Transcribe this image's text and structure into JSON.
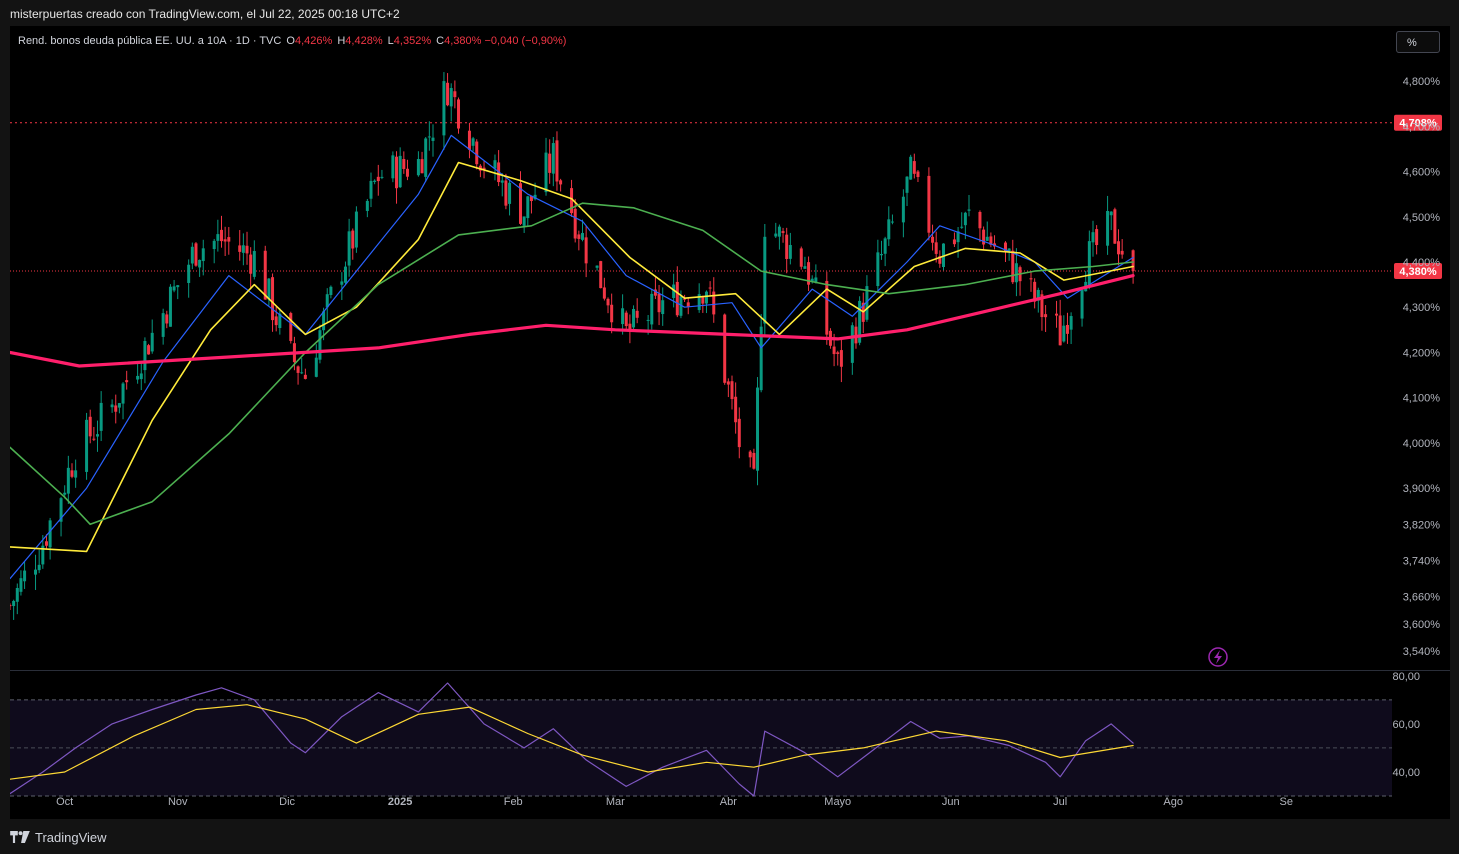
{
  "header": {
    "caption": "misterpuertas creado con TradingView.com, el Jul 22, 2025 00:18 UTC+2"
  },
  "legend": {
    "title": "Rend. bonos deuda pública EE. UU. a 10A · 1D · TVC",
    "o_label": "O",
    "o_value": "4,426%",
    "h_label": "H",
    "h_value": "4,428%",
    "l_label": "L",
    "l_value": "4,352%",
    "c_label": "C",
    "c_value": "4,380%",
    "change": "−0,040 (−0,90%)"
  },
  "unit_button": {
    "label": "%"
  },
  "footer": {
    "brand": "TradingView"
  },
  "colors": {
    "up": "#089981",
    "down": "#f23645",
    "ema_fast": "#2962ff",
    "ema_mid": "#ffeb3b",
    "sma_green": "#4caf50",
    "sma_long": "#ff1f6b",
    "rsi": "#7e57c2",
    "rsi_ma": "#fdd835",
    "price_label": "#f23645"
  },
  "chart_data": [
    {
      "type": "candlestick",
      "y_unit": "%",
      "ylim": [
        3.5,
        4.86
      ],
      "y_ticks": [
        "4,800%",
        "4,700%",
        "4,600%",
        "4,500%",
        "4,400%",
        "4,300%",
        "4,200%",
        "4,100%",
        "4,000%",
        "3,900%",
        "3,820%",
        "3,740%",
        "3,660%",
        "3,600%",
        "3,540%"
      ],
      "y_tick_values": [
        4.8,
        4.7,
        4.6,
        4.5,
        4.4,
        4.3,
        4.2,
        4.1,
        4.0,
        3.9,
        3.82,
        3.74,
        3.66,
        3.6,
        3.54
      ],
      "x_labels": [
        "Oct",
        "Nov",
        "Dic",
        "2025",
        "Feb",
        "Mar",
        "Abr",
        "Mayo",
        "Jun",
        "Jul",
        "Ago",
        "Se"
      ],
      "x_label_dates": [
        "2024-10-01",
        "2024-11-01",
        "2024-12-01",
        "2025-01-01",
        "2025-02-01",
        "2025-03-01",
        "2025-04-01",
        "2025-05-01",
        "2025-06-01",
        "2025-07-01",
        "2025-08-01",
        "2025-09-01"
      ],
      "x_range": [
        "2024-09-16",
        "2025-09-30"
      ],
      "close_series": {
        "name": "",
        "points": [
          [
            "2024-09-16",
            3.64
          ],
          [
            "2024-09-25",
            3.78
          ],
          [
            "2024-10-04",
            3.98
          ],
          [
            "2024-10-14",
            4.08
          ],
          [
            "2024-10-25",
            4.24
          ],
          [
            "2024-11-06",
            4.43
          ],
          [
            "2024-11-13",
            4.45
          ],
          [
            "2024-11-22",
            4.41
          ],
          [
            "2024-12-02",
            4.19
          ],
          [
            "2024-12-06",
            4.15
          ],
          [
            "2024-12-16",
            4.39
          ],
          [
            "2024-12-26",
            4.59
          ],
          [
            "2025-01-06",
            4.62
          ],
          [
            "2025-01-14",
            4.79
          ],
          [
            "2025-01-24",
            4.62
          ],
          [
            "2025-02-04",
            4.51
          ],
          [
            "2025-02-12",
            4.63
          ],
          [
            "2025-02-21",
            4.43
          ],
          [
            "2025-03-04",
            4.24
          ],
          [
            "2025-03-14",
            4.31
          ],
          [
            "2025-03-26",
            4.35
          ],
          [
            "2025-04-04",
            4.0
          ],
          [
            "2025-04-08",
            3.9
          ],
          [
            "2025-04-11",
            4.49
          ],
          [
            "2025-04-22",
            4.4
          ],
          [
            "2025-05-01",
            4.17
          ],
          [
            "2025-05-08",
            4.3
          ],
          [
            "2025-05-21",
            4.59
          ],
          [
            "2025-05-29",
            4.42
          ],
          [
            "2025-06-06",
            4.5
          ],
          [
            "2025-06-17",
            4.4
          ],
          [
            "2025-06-27",
            4.28
          ],
          [
            "2025-07-01",
            4.24
          ],
          [
            "2025-07-08",
            4.4
          ],
          [
            "2025-07-15",
            4.48
          ],
          [
            "2025-07-21",
            4.38
          ]
        ]
      },
      "ohlc_last": {
        "date": "2025-07-21",
        "open": 4.426,
        "high": 4.428,
        "low": 4.352,
        "close": 4.38
      },
      "moving_averages": [
        {
          "name": "",
          "color": "#2962ff",
          "points": [
            [
              "2024-09-16",
              3.7
            ],
            [
              "2024-10-07",
              3.9
            ],
            [
              "2024-10-28",
              4.18
            ],
            [
              "2024-11-15",
              4.37
            ],
            [
              "2024-12-06",
              4.24
            ],
            [
              "2024-12-20",
              4.38
            ],
            [
              "2025-01-06",
              4.55
            ],
            [
              "2025-01-15",
              4.68
            ],
            [
              "2025-02-05",
              4.55
            ],
            [
              "2025-02-20",
              4.49
            ],
            [
              "2025-03-04",
              4.37
            ],
            [
              "2025-03-20",
              4.3
            ],
            [
              "2025-04-02",
              4.31
            ],
            [
              "2025-04-10",
              4.21
            ],
            [
              "2025-04-24",
              4.34
            ],
            [
              "2025-05-05",
              4.28
            ],
            [
              "2025-05-20",
              4.4
            ],
            [
              "2025-05-29",
              4.48
            ],
            [
              "2025-06-12",
              4.44
            ],
            [
              "2025-06-24",
              4.4
            ],
            [
              "2025-07-03",
              4.32
            ],
            [
              "2025-07-21",
              4.41
            ]
          ]
        },
        {
          "name": "",
          "color": "#ffeb3b",
          "points": [
            [
              "2024-09-16",
              3.77
            ],
            [
              "2024-10-07",
              3.76
            ],
            [
              "2024-10-25",
              4.05
            ],
            [
              "2024-11-10",
              4.25
            ],
            [
              "2024-11-22",
              4.35
            ],
            [
              "2024-12-06",
              4.24
            ],
            [
              "2024-12-20",
              4.3
            ],
            [
              "2025-01-06",
              4.45
            ],
            [
              "2025-01-17",
              4.62
            ],
            [
              "2025-02-03",
              4.58
            ],
            [
              "2025-02-17",
              4.54
            ],
            [
              "2025-03-05",
              4.41
            ],
            [
              "2025-03-20",
              4.32
            ],
            [
              "2025-04-03",
              4.33
            ],
            [
              "2025-04-15",
              4.24
            ],
            [
              "2025-04-28",
              4.34
            ],
            [
              "2025-05-08",
              4.29
            ],
            [
              "2025-05-22",
              4.39
            ],
            [
              "2025-06-05",
              4.43
            ],
            [
              "2025-06-20",
              4.42
            ],
            [
              "2025-07-02",
              4.36
            ],
            [
              "2025-07-21",
              4.39
            ]
          ]
        },
        {
          "name": "",
          "color": "#4caf50",
          "points": [
            [
              "2024-09-16",
              3.99
            ],
            [
              "2024-10-01",
              3.88
            ],
            [
              "2024-10-08",
              3.82
            ],
            [
              "2024-10-25",
              3.87
            ],
            [
              "2024-11-15",
              4.02
            ],
            [
              "2024-12-06",
              4.2
            ],
            [
              "2024-12-26",
              4.35
            ],
            [
              "2025-01-17",
              4.46
            ],
            [
              "2025-02-06",
              4.48
            ],
            [
              "2025-02-20",
              4.53
            ],
            [
              "2025-03-06",
              4.52
            ],
            [
              "2025-03-25",
              4.47
            ],
            [
              "2025-04-10",
              4.38
            ],
            [
              "2025-04-28",
              4.35
            ],
            [
              "2025-05-15",
              4.33
            ],
            [
              "2025-06-05",
              4.35
            ],
            [
              "2025-06-24",
              4.38
            ],
            [
              "2025-07-10",
              4.39
            ],
            [
              "2025-07-21",
              4.4
            ]
          ]
        },
        {
          "name": "",
          "color": "#ff1f6b",
          "points": [
            [
              "2024-09-16",
              4.2
            ],
            [
              "2024-10-05",
              4.17
            ],
            [
              "2024-11-15",
              4.19
            ],
            [
              "2024-12-26",
              4.21
            ],
            [
              "2025-01-20",
              4.24
            ],
            [
              "2025-02-10",
              4.26
            ],
            [
              "2025-03-01",
              4.25
            ],
            [
              "2025-04-01",
              4.24
            ],
            [
              "2025-05-01",
              4.23
            ],
            [
              "2025-05-20",
              4.25
            ],
            [
              "2025-06-10",
              4.29
            ],
            [
              "2025-07-01",
              4.33
            ],
            [
              "2025-07-21",
              4.37
            ]
          ]
        }
      ],
      "price_lines": [
        {
          "label": "4,708%",
          "value": 4.708,
          "style": "dotted"
        },
        {
          "label": "4,380%",
          "value": 4.38,
          "style": "dotted"
        }
      ]
    },
    {
      "type": "line",
      "ylim": [
        30,
        82
      ],
      "y_ticks": [
        "80,00",
        "60,00",
        "40,00"
      ],
      "y_tick_values": [
        80,
        60,
        40
      ],
      "bands": [
        30,
        70
      ],
      "midline": 50,
      "series": [
        {
          "name": "",
          "color": "#7e57c2",
          "points": [
            [
              "2024-09-16",
              31
            ],
            [
              "2024-09-25",
              40
            ],
            [
              "2024-10-04",
              50
            ],
            [
              "2024-10-14",
              60
            ],
            [
              "2024-10-25",
              66
            ],
            [
              "2024-11-06",
              72
            ],
            [
              "2024-11-13",
              75
            ],
            [
              "2024-11-22",
              70
            ],
            [
              "2024-12-02",
              52
            ],
            [
              "2024-12-06",
              48
            ],
            [
              "2024-12-16",
              63
            ],
            [
              "2024-12-26",
              73
            ],
            [
              "2025-01-06",
              65
            ],
            [
              "2025-01-14",
              77
            ],
            [
              "2025-01-24",
              60
            ],
            [
              "2025-02-04",
              50
            ],
            [
              "2025-02-12",
              58
            ],
            [
              "2025-02-21",
              45
            ],
            [
              "2025-03-04",
              34
            ],
            [
              "2025-03-14",
              42
            ],
            [
              "2025-03-26",
              49
            ],
            [
              "2025-04-04",
              35
            ],
            [
              "2025-04-08",
              30
            ],
            [
              "2025-04-11",
              57
            ],
            [
              "2025-04-22",
              48
            ],
            [
              "2025-05-01",
              38
            ],
            [
              "2025-05-08",
              46
            ],
            [
              "2025-05-21",
              61
            ],
            [
              "2025-05-29",
              54
            ],
            [
              "2025-06-06",
              55
            ],
            [
              "2025-06-17",
              51
            ],
            [
              "2025-06-27",
              44
            ],
            [
              "2025-07-01",
              38
            ],
            [
              "2025-07-08",
              53
            ],
            [
              "2025-07-15",
              60
            ],
            [
              "2025-07-21",
              52
            ]
          ]
        },
        {
          "name": "",
          "color": "#fdd835",
          "points": [
            [
              "2024-09-16",
              37
            ],
            [
              "2024-10-01",
              40
            ],
            [
              "2024-10-20",
              55
            ],
            [
              "2024-11-06",
              66
            ],
            [
              "2024-11-20",
              68
            ],
            [
              "2024-12-06",
              62
            ],
            [
              "2024-12-20",
              52
            ],
            [
              "2025-01-06",
              64
            ],
            [
              "2025-01-20",
              67
            ],
            [
              "2025-02-05",
              56
            ],
            [
              "2025-02-20",
              47
            ],
            [
              "2025-03-10",
              40
            ],
            [
              "2025-03-26",
              44
            ],
            [
              "2025-04-08",
              42
            ],
            [
              "2025-04-22",
              47
            ],
            [
              "2025-05-08",
              50
            ],
            [
              "2025-05-28",
              57
            ],
            [
              "2025-06-16",
              53
            ],
            [
              "2025-07-01",
              46
            ],
            [
              "2025-07-21",
              51
            ]
          ]
        }
      ]
    }
  ]
}
